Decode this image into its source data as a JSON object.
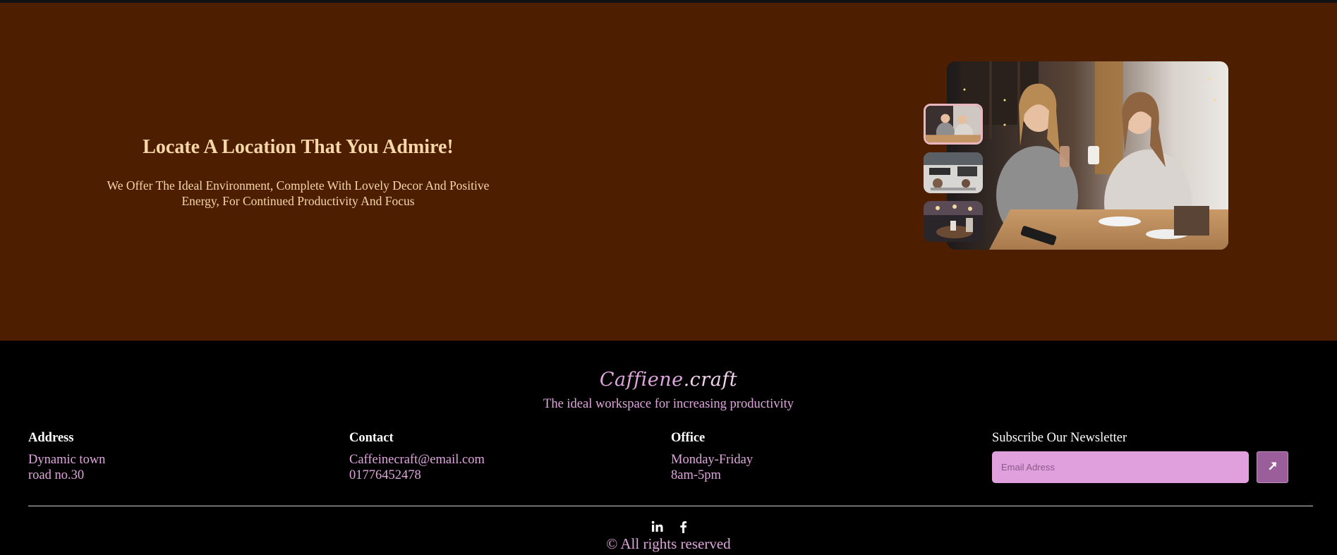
{
  "hero": {
    "title": "Locate A Location That You Admire!",
    "description": "We Offer The Ideal Environment, Complete With Lovely Decor And Positive Energy, For Continued Productivity And Focus",
    "gallery": {
      "main_image": "two-women-toasting-coffee-cafe-photo",
      "thumbnails": [
        "cafe-women-thumbnail",
        "cafe-workspace-thumbnail",
        "cafe-table-thumbnail"
      ],
      "active_thumbnail": 1
    }
  },
  "footer": {
    "brand_part1": "Caffiene",
    "brand_part2": ".craft",
    "tagline": "The ideal workspace for increasing productivity",
    "address": {
      "heading": "Address",
      "line1": "Dynamic town",
      "line2": "road no.30"
    },
    "contact": {
      "heading": "Contact",
      "email": "Caffeinecraft@email.com",
      "phone": "01776452478"
    },
    "office": {
      "heading": "Office",
      "days": "Monday-Friday",
      "hours": "8am-5pm"
    },
    "newsletter": {
      "heading": "Subscribe Our Newsletter",
      "placeholder": "Email Adress",
      "submit_icon": "arrow-up-right-icon"
    },
    "social": [
      "linkedin-icon",
      "facebook-icon"
    ],
    "copyright": "© All rights reserved"
  },
  "colors": {
    "hero_bg": "#4d1f00",
    "hero_text": "#f6d7a8",
    "accent": "#e0a5de",
    "footer_bg": "#000000"
  }
}
